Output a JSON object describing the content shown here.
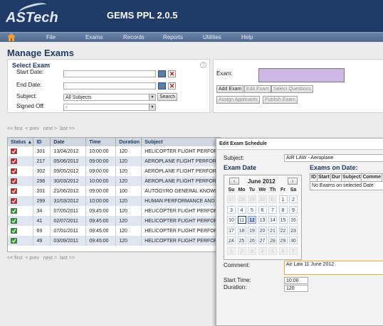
{
  "app": {
    "logo": "ASTech",
    "title": "GEMS PPL 2.0.5"
  },
  "menu": [
    "File",
    "Exams",
    "Records",
    "Reports",
    "Utilities",
    "Help"
  ],
  "page_title": "Manage Exams",
  "select_exam": {
    "title": "Select Exam",
    "start_label": "Start Date:",
    "end_label": "End Date:",
    "subject_label": "Subject:",
    "subject_value": "All Subjects",
    "search_label": "Search",
    "signed_off_label": "Signed Off:",
    "signed_off_value": "-"
  },
  "exam_panel": {
    "exam_label": "Exam:",
    "buttons": [
      "Add Exam",
      "Edit Exam",
      "Select Questions",
      "Assign Applicants",
      "Publish Exam"
    ]
  },
  "pager": {
    "first": "<< first",
    "prev": "< prev",
    "next": "next >",
    "last": "last >>"
  },
  "table": {
    "columns": [
      "Status",
      "ID",
      "Date",
      "Time",
      "Duration",
      "Subject"
    ],
    "rows": [
      {
        "status": "red",
        "id": "301",
        "date": "13/04/2012",
        "time": "10:00:00",
        "duration": "120",
        "subject": "HELICOPTER FLIGHT PERFORMANCE"
      },
      {
        "status": "red",
        "id": "217",
        "date": "05/06/2012",
        "time": "09:00:00",
        "duration": "120",
        "subject": "AEROPLANE FLIGHT PERFORMANCE"
      },
      {
        "status": "red",
        "id": "302",
        "date": "09/05/2012",
        "time": "09:00:00",
        "duration": "120",
        "subject": "AEROPLANE FLIGHT PERFORMANCE"
      },
      {
        "status": "red",
        "id": "298",
        "date": "30/03/2012",
        "time": "10:00:00",
        "duration": "120",
        "subject": "AEROPLANE FLIGHT PERFORMANCE"
      },
      {
        "status": "red",
        "id": "201",
        "date": "21/06/2012",
        "time": "09:00:00",
        "duration": "100",
        "subject": "AUTOGYRO GENERAL KNOWLEDGE"
      },
      {
        "status": "red",
        "id": "299",
        "date": "31/03/2012",
        "time": "10:00:00",
        "duration": "120",
        "subject": "HUMAN PERFORMANCE AND LIMITATIONS"
      },
      {
        "status": "green",
        "id": "34",
        "date": "07/05/2011",
        "time": "09:45:00",
        "duration": "120",
        "subject": "HELICOPTER FLIGHT PERFORMANCE"
      },
      {
        "status": "green",
        "id": "41",
        "date": "02/07/2011",
        "time": "09:45:00",
        "duration": "120",
        "subject": "HELICOPTER FLIGHT PERFORMANCE"
      },
      {
        "status": "green",
        "id": "69",
        "date": "07/01/2011",
        "time": "09:45:00",
        "duration": "120",
        "subject": "HELICOPTER FLIGHT PERFORMANCE"
      },
      {
        "status": "green",
        "id": "49",
        "date": "03/09/2011",
        "time": "09:45:00",
        "duration": "120",
        "subject": "HELICOPTER FLIGHT PERFORMANCE"
      }
    ]
  },
  "dialog": {
    "title": "Edit Exam Schedule",
    "subject_label": "Subject:",
    "subject_value": "AIR LAW - Aeroplane",
    "exam_date_label": "Exam Date",
    "exams_on_date_label": "Exams on Date:",
    "eod_columns": [
      "ID",
      "Start",
      "Dur",
      "Subject",
      "Comme"
    ],
    "eod_empty": "No Exams on selected Date",
    "calendar": {
      "month": "June 2012",
      "weekdays": [
        "Su",
        "Mo",
        "Tu",
        "We",
        "Th",
        "Fr",
        "Sa"
      ],
      "weeks": [
        [
          "27",
          "28",
          "29",
          "30",
          "31",
          "1",
          "2"
        ],
        [
          "3",
          "4",
          "5",
          "6",
          "7",
          "8",
          "9"
        ],
        [
          "10",
          "11",
          "12",
          "13",
          "14",
          "15",
          "16"
        ],
        [
          "17",
          "18",
          "19",
          "20",
          "21",
          "22",
          "23"
        ],
        [
          "24",
          "25",
          "26",
          "27",
          "28",
          "29",
          "30"
        ],
        [
          "1",
          "2",
          "3",
          "4",
          "5",
          "6",
          "7"
        ]
      ]
    },
    "comment_label": "Comment:",
    "comment_value": "Air Law 11 June 2012",
    "start_time_label": "Start Time:",
    "start_time_value": "10:00",
    "duration_label": "Duration:",
    "duration_value": "120"
  },
  "colors": {
    "header": "#1f3b66",
    "status_red": "#cc2222",
    "status_green": "#2a9a2a",
    "selection": "#cfe0f4"
  }
}
